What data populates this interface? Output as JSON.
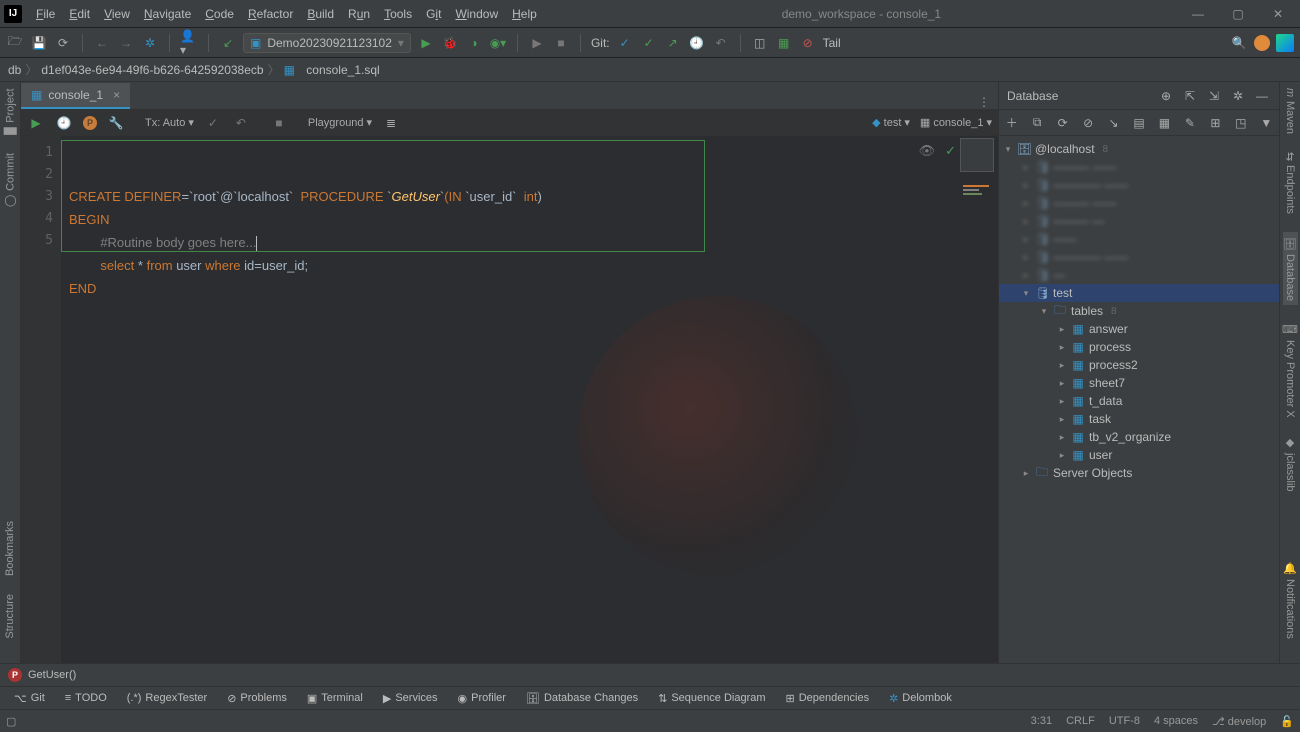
{
  "window": {
    "title": "demo_workspace - console_1"
  },
  "menu": {
    "file": "File",
    "edit": "Edit",
    "view": "View",
    "navigate": "Navigate",
    "code": "Code",
    "refactor": "Refactor",
    "build": "Build",
    "run": "Run",
    "tools": "Tools",
    "git": "Git",
    "window": "Window",
    "help": "Help"
  },
  "toolbar": {
    "run_config": "Demo20230921123102",
    "git_label": "Git:",
    "tail": "Tail"
  },
  "breadcrumb": {
    "a": "db",
    "b": "d1ef043e-6e94-49f6-b626-642592038ecb",
    "c": "console_1.sql"
  },
  "tabs": {
    "active": "console_1"
  },
  "editor_toolbar": {
    "tx": "Tx: Auto",
    "playground": "Playground",
    "ds": "test",
    "console": "console_1"
  },
  "code": {
    "l1_a": "CREATE DEFINER",
    "l1_b": "=",
    "l1_c": "`root`",
    "l1_d": "@",
    "l1_e": "`localhost`",
    "l1_f": "  PROCEDURE ",
    "l1_g": "`",
    "l1_h": "GetUser",
    "l1_i": "`",
    "l1_j": "(IN ",
    "l1_k": "`user_id`",
    "l1_l": "  int",
    "l2": "BEGIN",
    "l3": "#Routine body goes here...",
    "l4a": "select",
    "l4b": " * ",
    "l4c": "from",
    "l4d": " user ",
    "l4e": "where",
    "l4f": " id=user_id;",
    "l5": "END"
  },
  "database_panel": {
    "title": "Database",
    "root_host": "@localhost",
    "root_count": "8",
    "blurred": [
      "——— ——",
      "———— ——",
      "——— ——",
      "——— —",
      "——",
      "———— ——",
      "—"
    ],
    "selected_db": "test",
    "tables_label": "tables",
    "tables_count": "8",
    "tables": [
      "answer",
      "process",
      "process2",
      "sheet7",
      "t_data",
      "task",
      "tb_v2_organize",
      "user"
    ],
    "server_objects": "Server Objects"
  },
  "left_strip": {
    "project": "Project",
    "commit": "Commit",
    "bookmarks": "Bookmarks",
    "structure": "Structure"
  },
  "right_strip": {
    "maven": "Maven",
    "endpoints": "Endpoints",
    "database": "Database",
    "keypromoter": "Key Promoter X",
    "jclasslib": "jclasslib",
    "notifications": "Notifications"
  },
  "bottom_crumb": {
    "fn": "GetUser()"
  },
  "tool_windows": {
    "git": "Git",
    "todo": "TODO",
    "regex": "RegexTester",
    "problems": "Problems",
    "terminal": "Terminal",
    "services": "Services",
    "profiler": "Profiler",
    "dbchanges": "Database Changes",
    "seqdiag": "Sequence Diagram",
    "deps": "Dependencies",
    "delombok": "Delombok"
  },
  "status": {
    "pos": "3:31",
    "eol": "CRLF",
    "enc": "UTF-8",
    "indent": "4 spaces",
    "branch": "develop"
  }
}
